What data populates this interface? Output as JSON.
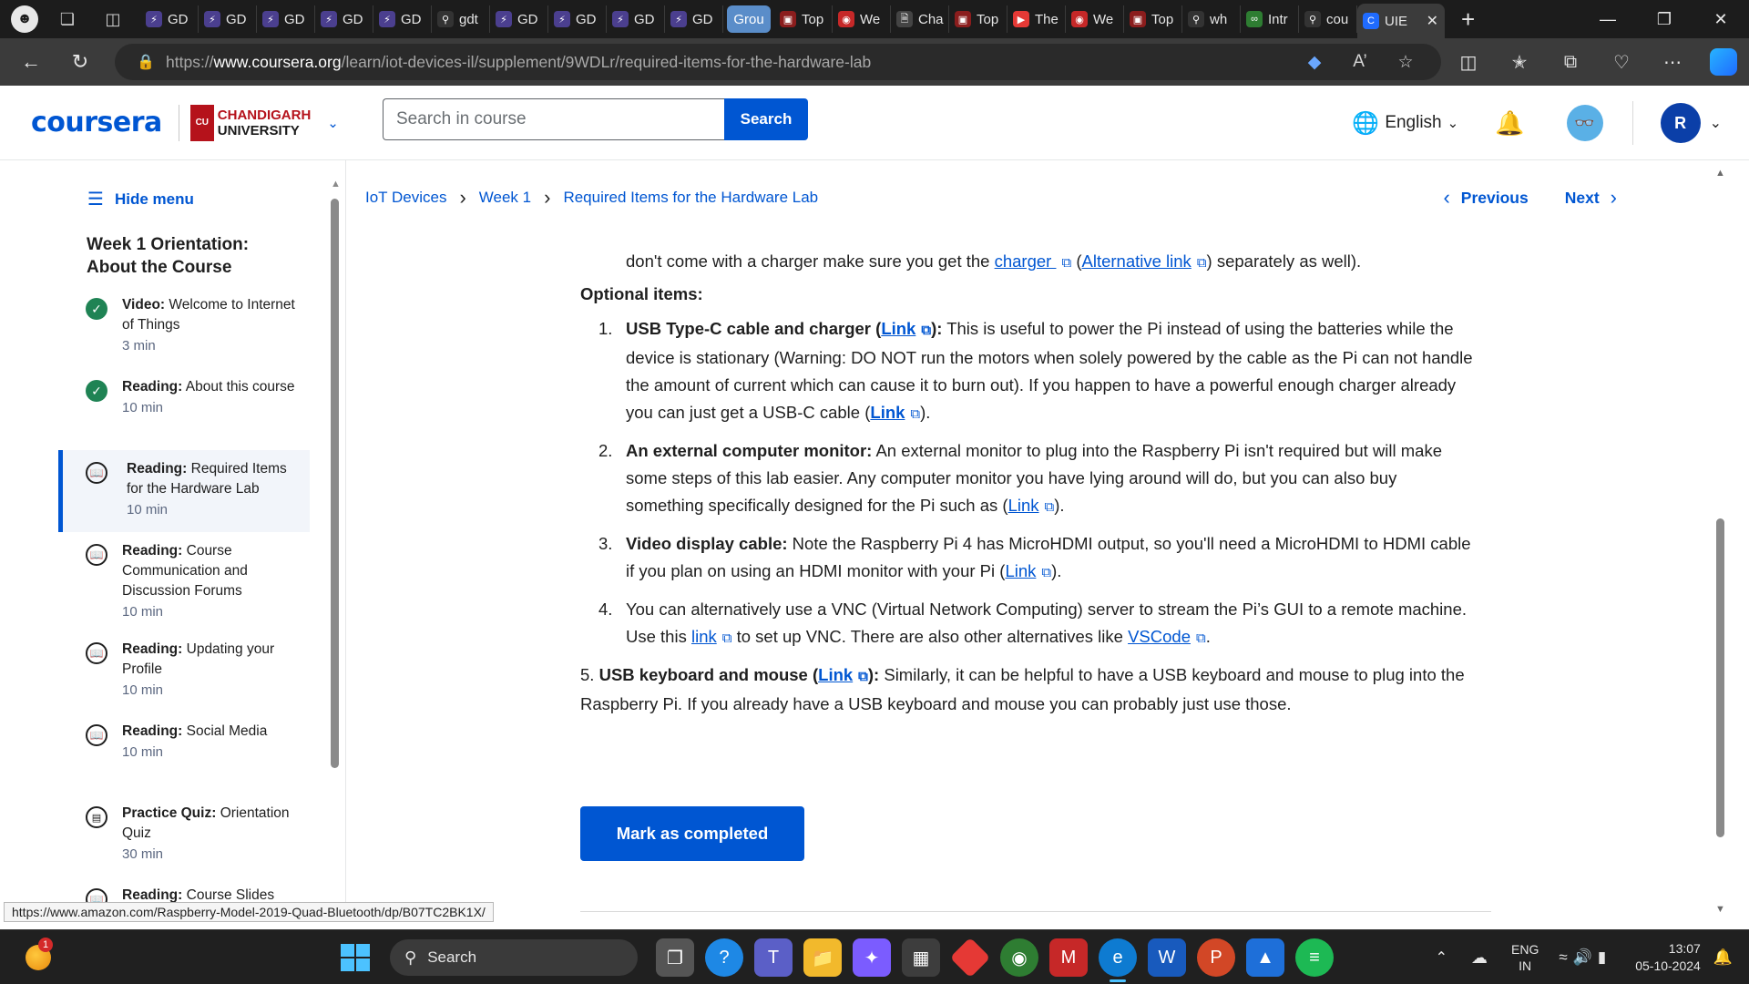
{
  "browser": {
    "tabs": [
      {
        "label": "GD",
        "icon": "bolt-icon"
      },
      {
        "label": "GD",
        "icon": "bolt-icon"
      },
      {
        "label": "GD",
        "icon": "bolt-icon"
      },
      {
        "label": "GD",
        "icon": "bolt-icon"
      },
      {
        "label": "GD",
        "icon": "bolt-icon"
      },
      {
        "label": "gdt",
        "icon": "search-icon"
      },
      {
        "label": "GD",
        "icon": "bolt-icon"
      },
      {
        "label": "GD",
        "icon": "bolt-icon"
      },
      {
        "label": "GD",
        "icon": "bolt-icon"
      },
      {
        "label": "GD",
        "icon": "bolt-icon"
      },
      {
        "label": "Grou",
        "icon": "group"
      },
      {
        "label": "Top",
        "icon": "video-icon"
      },
      {
        "label": "We",
        "icon": "web-icon"
      },
      {
        "label": "Cha",
        "icon": "doc-icon"
      },
      {
        "label": "Top",
        "icon": "video-icon"
      },
      {
        "label": "The",
        "icon": "youtube-icon"
      },
      {
        "label": "We",
        "icon": "web-icon"
      },
      {
        "label": "Top",
        "icon": "video-icon"
      },
      {
        "label": "wh",
        "icon": "search-icon"
      },
      {
        "label": "Intr",
        "icon": "infinity-icon"
      },
      {
        "label": "cou",
        "icon": "search-icon"
      },
      {
        "label": "UIE",
        "icon": "coursera-icon"
      }
    ],
    "new_tab": "+",
    "url_prefix": "https://",
    "url_domain": "www.coursera.org",
    "url_path": "/learn/iot-devices-il/supplement/9WDLr/required-items-for-the-hardware-lab"
  },
  "header": {
    "logo": "coursera",
    "partner_line1": "CHANDIGARH",
    "partner_line2": "UNIVERSITY",
    "partner_badge": "CU",
    "search_placeholder": "Search in course",
    "search_button": "Search",
    "language": "English",
    "user_initial": "R"
  },
  "sidebar": {
    "hide_menu": "Hide menu",
    "week_title": "Week 1 Orientation: About the Course",
    "items": [
      {
        "type": "Video:",
        "title": "Welcome to Internet of Things",
        "duration": "3 min",
        "status": "completed"
      },
      {
        "type": "Reading:",
        "title": "About this course",
        "duration": "10 min",
        "status": "completed"
      },
      {
        "type": "Reading:",
        "title": "Required Items for the Hardware Lab",
        "duration": "10 min",
        "status": "active"
      },
      {
        "type": "Reading:",
        "title": "Course Communication and Discussion Forums",
        "duration": "10 min",
        "status": "todo"
      },
      {
        "type": "Reading:",
        "title": "Updating your Profile",
        "duration": "10 min",
        "status": "todo"
      },
      {
        "type": "Reading:",
        "title": "Social Media",
        "duration": "10 min",
        "status": "todo"
      },
      {
        "type": "Practice Quiz:",
        "title": "Orientation Quiz",
        "duration": "30 min",
        "status": "todo"
      },
      {
        "type": "Reading:",
        "title": "Course Slides PDFs",
        "duration": "",
        "status": "todo"
      }
    ]
  },
  "main": {
    "breadcrumb": [
      "IoT Devices",
      "Week 1",
      "Required Items for the Hardware Lab"
    ],
    "previous": "Previous",
    "next": "Next",
    "intro_text_a": "don't come with a charger make sure you get the ",
    "intro_link1": "charger ",
    "intro_text_b": " (",
    "intro_link2": "Alternative link",
    "intro_text_c": ") separately as well).",
    "optional_heading": "Optional items:",
    "list": [
      {
        "num": "1.",
        "bold": "USB Type-C cable and charger (",
        "link": "Link",
        "bold_end": "):",
        "text": " This is useful to power the Pi instead of using the batteries while the device is stationary (Warning: DO NOT run the motors when solely powered by the cable as the Pi can not handle the amount of current which can cause it to burn out). If you happen to have a powerful enough charger already you can just get a USB-C cable (",
        "link2": "Link",
        "text_end": ")."
      },
      {
        "num": "2.",
        "bold": "An external computer monitor:",
        "text": " An external monitor to plug into the Raspberry Pi isn't required but will make some steps of this lab easier. Any computer monitor you have lying around will do, but you can also buy something specifically designed for the Pi such as (",
        "link": "Link",
        "text_end": ")."
      },
      {
        "num": "3.",
        "bold": "Video display cable:",
        "text": " Note the Raspberry Pi 4 has MicroHDMI output, so you'll need a MicroHDMI to HDMI cable if you plan on using an HDMI monitor with your Pi (",
        "link": "Link",
        "text_end": ")."
      },
      {
        "num": "4.",
        "text": "You can alternatively use a VNC (Virtual Network Computing) server to stream the Pi’s GUI to a remote machine. Use this ",
        "link": "link",
        "text_mid": " to set up VNC. There are also other alternatives like ",
        "link2": "VSCode",
        "text_end": "."
      }
    ],
    "item5_num": "5.",
    "item5_bold": "USB keyboard and mouse (",
    "item5_link": "Link",
    "item5_bold_end": "):",
    "item5_text": " Similarly, it can be helpful to have a USB keyboard and mouse to plug into the Raspberry Pi. If you already have a USB keyboard and mouse you can probably just use those.",
    "mark_completed": "Mark as completed"
  },
  "status_url": "https://www.amazon.com/Raspberry-Model-2019-Quad-Bluetooth/dp/B07TC2BK1X/",
  "taskbar": {
    "weather_badge": "1",
    "search_label": "Search",
    "lang_line1": "ENG",
    "lang_line2": "IN",
    "time": "13:07",
    "date": "05-10-2024"
  }
}
